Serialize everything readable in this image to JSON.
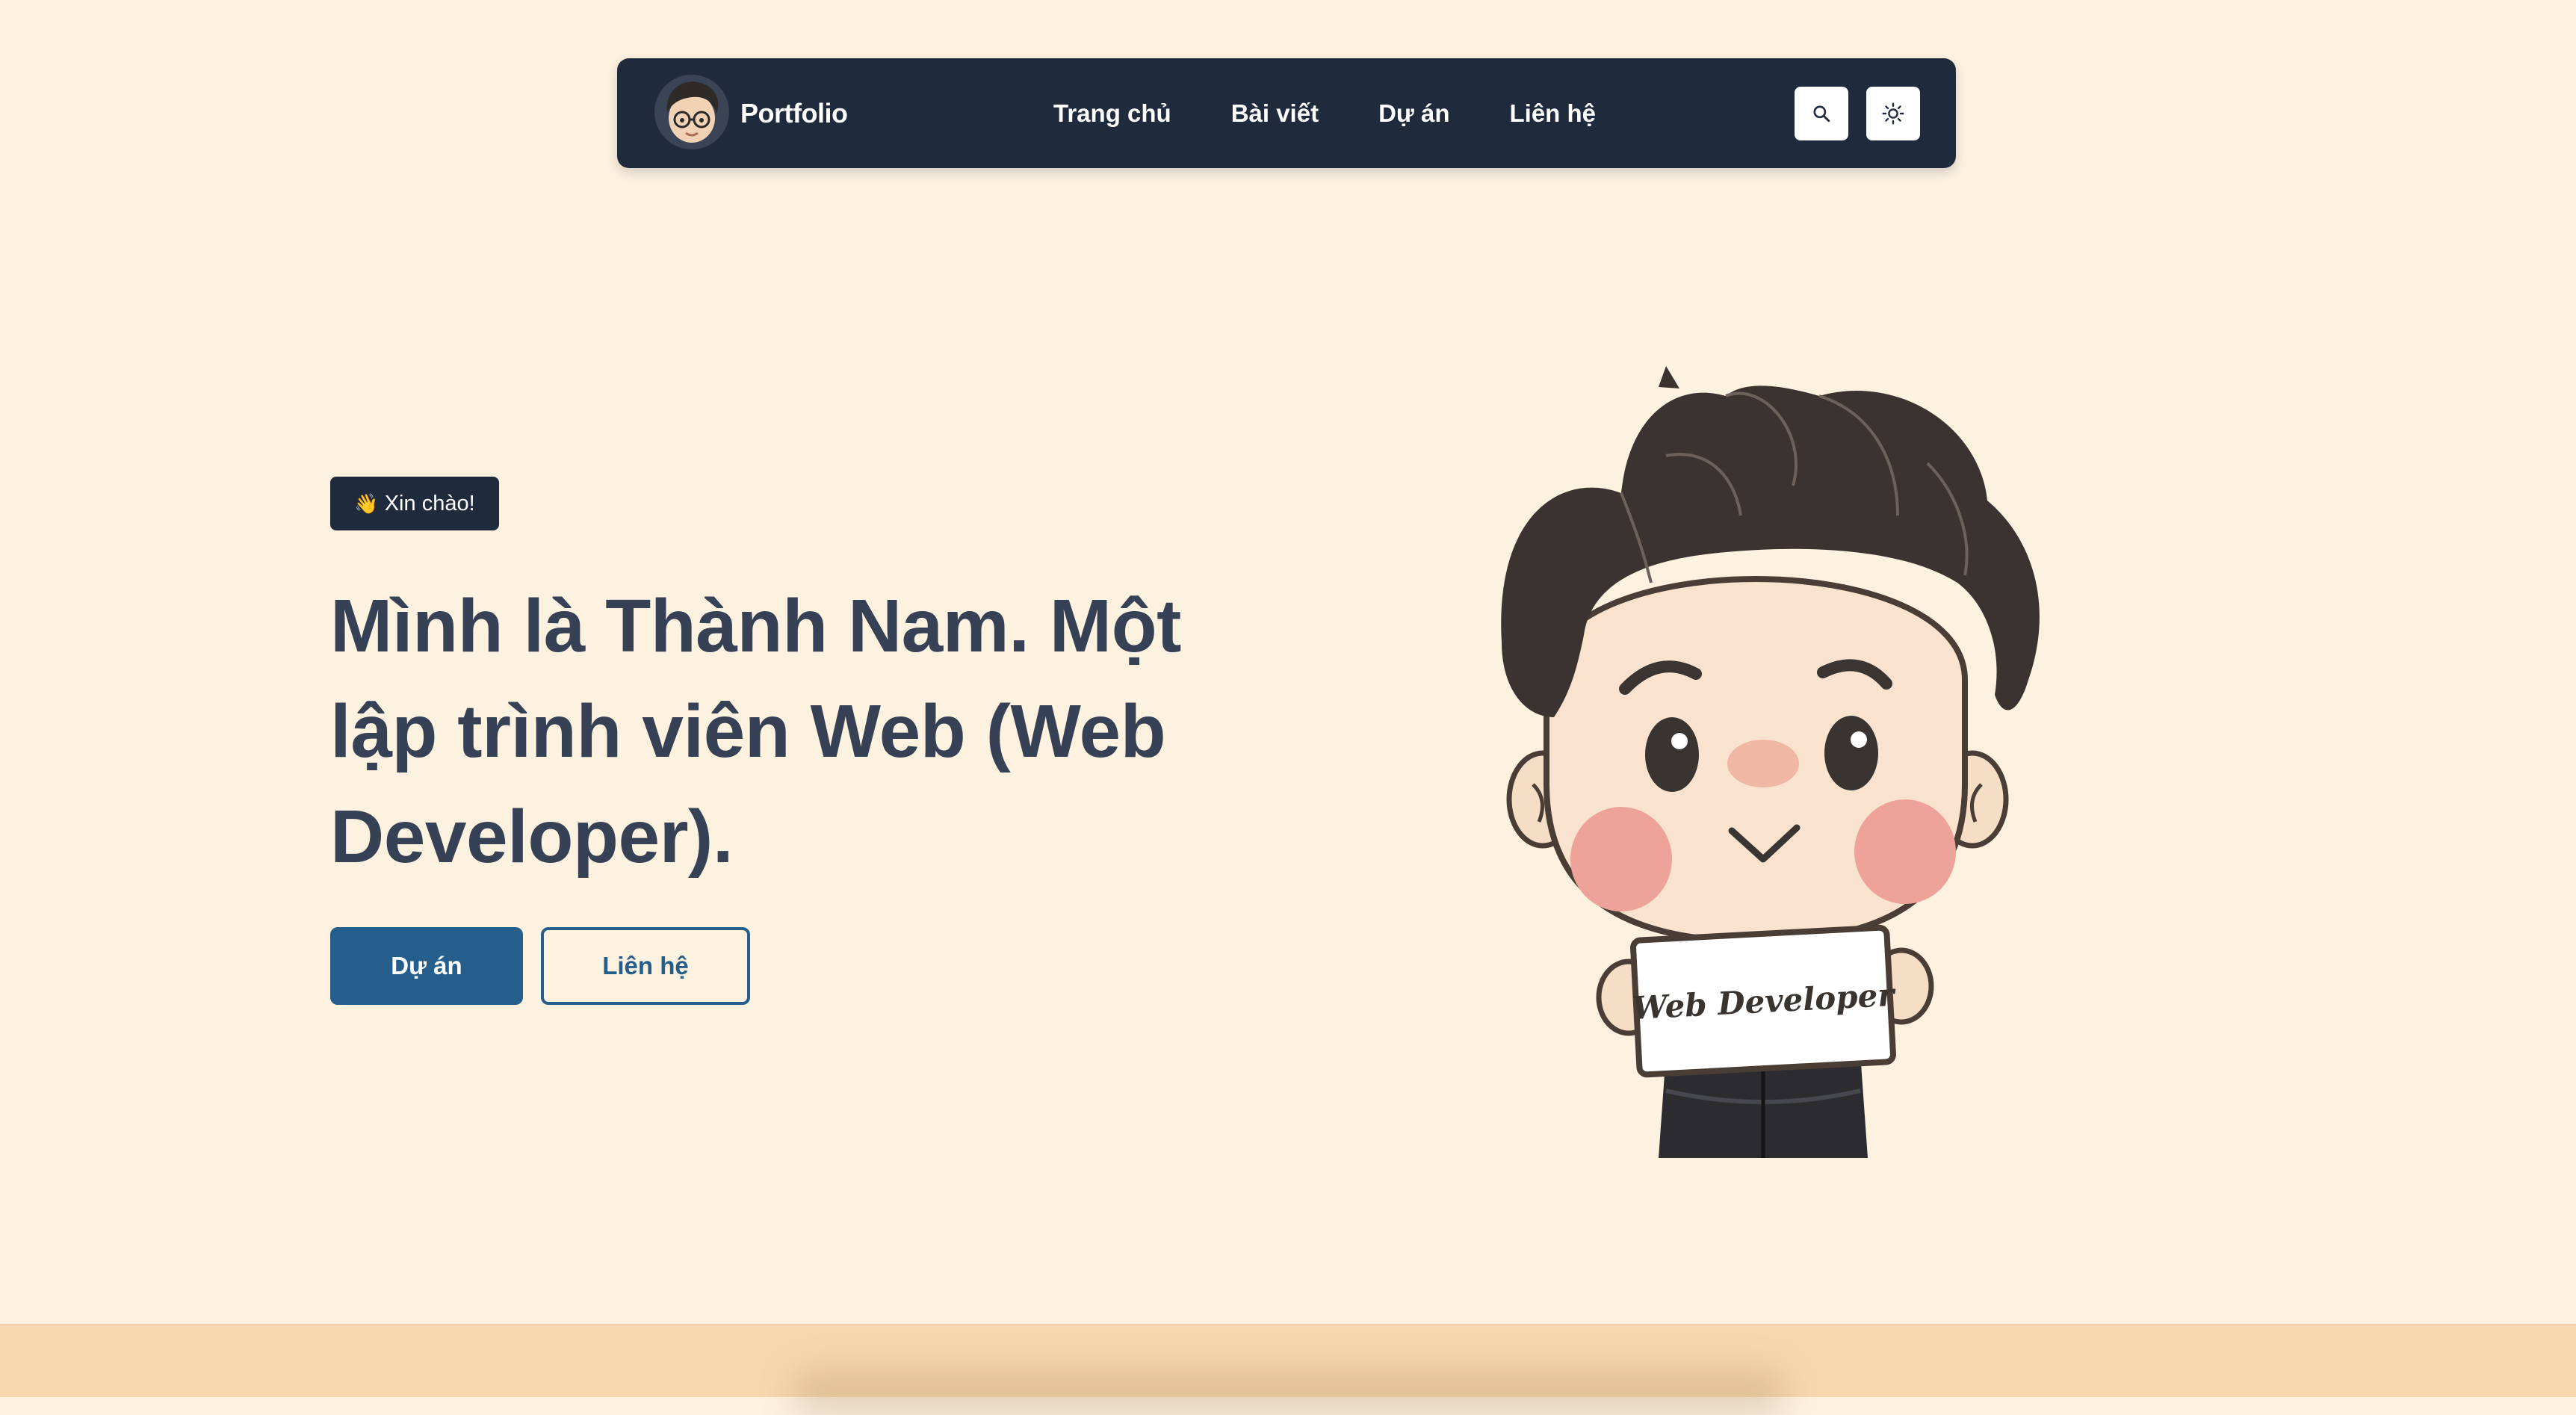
{
  "nav": {
    "brand": "Portfolio",
    "links": [
      "Trang chủ",
      "Bài viết",
      "Dự án",
      "Liên hệ"
    ],
    "search_icon": "search-icon",
    "theme_icon": "sun-icon"
  },
  "hero": {
    "badge": "Xin chào!",
    "badge_icon": "waving-hand-icon",
    "title": "Mình là Thành Nam. Một lập trình viên Web (Web Developer).",
    "primary_button": "Dự án",
    "secondary_button": "Liên hệ"
  },
  "illustration": {
    "sign_text": "Web Developer"
  },
  "colors": {
    "background": "#fdf1df",
    "navbar": "#1f2a3c",
    "accent": "#255e8a",
    "title": "#364155",
    "footer_band": "#f6d7ae"
  }
}
